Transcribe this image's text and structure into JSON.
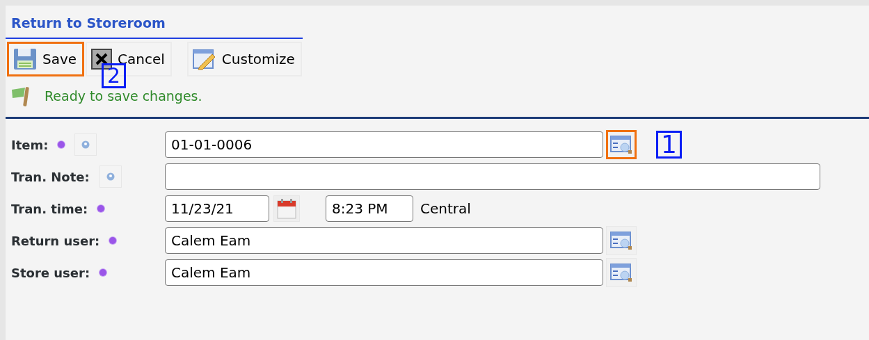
{
  "title": "Return to Storeroom",
  "toolbar": [
    {
      "kind": "save",
      "label": "Save",
      "highlighted": true
    },
    {
      "kind": "cancel",
      "label": "Cancel",
      "highlighted": false,
      "callout": "2"
    },
    {
      "kind": "customize",
      "label": "Customize",
      "highlighted": false
    }
  ],
  "status": "Ready to save changes.",
  "fields": [
    {
      "kind": "lookup",
      "label": "Item:",
      "required": true,
      "help": true,
      "value": "01-01-0006",
      "lookup_highlighted": true,
      "callout": "1"
    },
    {
      "kind": "text",
      "label": "Tran. Note:",
      "help": true
    },
    {
      "kind": "datetime",
      "label": "Tran. time:",
      "required": true,
      "date": "11/23/21",
      "time": "8:23 PM",
      "zone": "Central"
    },
    {
      "kind": "lookup",
      "label": "Return user:",
      "required": true,
      "value": "Calem Eam",
      "lookup_highlighted": false
    },
    {
      "kind": "lookup",
      "label": "Store user:",
      "required": true,
      "value": "Calem Eam",
      "lookup_highlighted": false
    }
  ]
}
